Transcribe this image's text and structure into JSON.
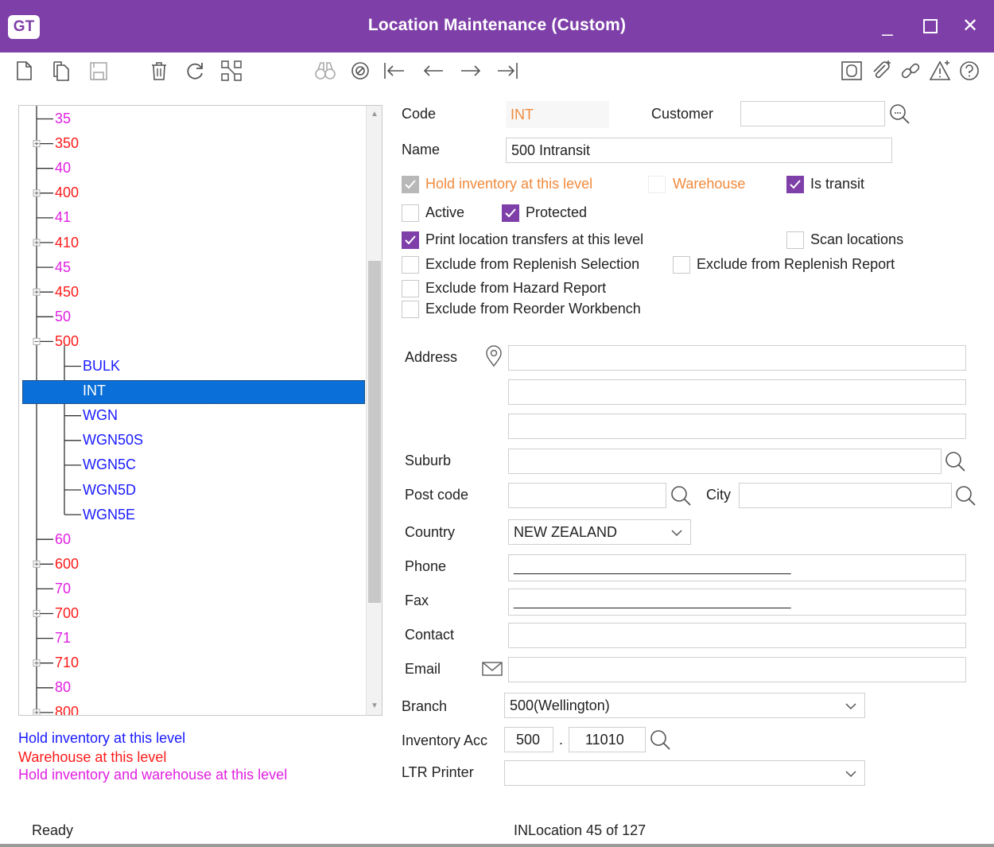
{
  "window": {
    "logo": "GT",
    "title": "Location Maintenance (Custom)",
    "minimize_glyph": "_",
    "maximize_glyph": "☐",
    "close_glyph": "✕"
  },
  "toolbar": {
    "left_icons": [
      "new-document-icon",
      "copy-document-icon",
      "save-icon",
      "delete-icon",
      "refresh-icon",
      "structure-icon"
    ],
    "nav_icons": [
      "binoculars-icon",
      "target-icon",
      "first-record-icon",
      "previous-record-icon",
      "next-record-icon",
      "last-record-icon"
    ],
    "right_icons": [
      "notes-icon",
      "attachment-icon",
      "link-icon",
      "alert-icon",
      "help-icon"
    ]
  },
  "tree": {
    "nodes": [
      {
        "label": "35",
        "color": "mag"
      },
      {
        "label": "350",
        "color": "red"
      },
      {
        "label": "40",
        "color": "mag"
      },
      {
        "label": "400",
        "color": "red"
      },
      {
        "label": "41",
        "color": "mag"
      },
      {
        "label": "410",
        "color": "red"
      },
      {
        "label": "45",
        "color": "mag"
      },
      {
        "label": "450",
        "color": "red"
      },
      {
        "label": "50",
        "color": "mag"
      },
      {
        "label": "500",
        "color": "red"
      },
      {
        "label": "BULK",
        "color": "blue"
      },
      {
        "label": "INT",
        "color": "sel"
      },
      {
        "label": "WGN",
        "color": "blue"
      },
      {
        "label": "WGN50S",
        "color": "blue"
      },
      {
        "label": "WGN5C",
        "color": "blue"
      },
      {
        "label": "WGN5D",
        "color": "blue"
      },
      {
        "label": "WGN5E",
        "color": "blue"
      },
      {
        "label": "60",
        "color": "mag"
      },
      {
        "label": "600",
        "color": "red"
      },
      {
        "label": "70",
        "color": "mag"
      },
      {
        "label": "700",
        "color": "red"
      },
      {
        "label": "71",
        "color": "mag"
      },
      {
        "label": "710",
        "color": "red"
      },
      {
        "label": "80",
        "color": "mag"
      },
      {
        "label": "800",
        "color": "red"
      }
    ]
  },
  "legend": {
    "hold": "Hold inventory at this level",
    "warehouse": "Warehouse at this level",
    "both": "Hold inventory and warehouse at this level",
    "colors": {
      "hold": "#1a1aff",
      "warehouse": "#ff1a1a",
      "both": "#e01fe0"
    }
  },
  "form": {
    "code_label": "Code",
    "code_value": "INT",
    "customer_label": "Customer",
    "customer_value": "",
    "name_label": "Name",
    "name_value": "500 Intransit",
    "checkboxes": {
      "hold_inventory": {
        "label": "Hold inventory at this level",
        "checked": true
      },
      "warehouse": {
        "label": "Warehouse",
        "checked": false
      },
      "is_transit": {
        "label": "Is transit",
        "checked": true
      },
      "active": {
        "label": "Active",
        "checked": false
      },
      "protected": {
        "label": "Protected",
        "checked": true
      },
      "print_transfers": {
        "label": "Print location transfers at this level",
        "checked": true
      },
      "scan_locations": {
        "label": "Scan locations",
        "checked": false
      },
      "excl_replenish_sel": {
        "label": "Exclude from Replenish Selection",
        "checked": false
      },
      "excl_replenish_rep": {
        "label": "Exclude from Replenish Report",
        "checked": false
      },
      "excl_hazard": {
        "label": "Exclude from Hazard Report",
        "checked": false
      },
      "excl_reorder": {
        "label": "Exclude from Reorder Workbench",
        "checked": false
      }
    },
    "address_label": "Address",
    "address_line1": "",
    "address_line2": "",
    "address_line3": "",
    "suburb_label": "Suburb",
    "suburb_value": "",
    "postcode_label": "Post code",
    "postcode_value": "",
    "city_label": "City",
    "city_value": "",
    "country_label": "Country",
    "country_value": "NEW ZEALAND",
    "phone_label": "Phone",
    "phone_value": "____________________________________________",
    "fax_label": "Fax",
    "fax_value": "____________________________________________",
    "contact_label": "Contact",
    "contact_value": "",
    "email_label": "Email",
    "email_value": "",
    "branch_label": "Branch",
    "branch_value": "500(Wellington)",
    "inventory_acc_label": "Inventory Acc",
    "inventory_acc_part1": "500",
    "inventory_acc_sep": ".",
    "inventory_acc_part2": "11010",
    "ltr_printer_label": "LTR Printer",
    "ltr_printer_value": ""
  },
  "status": {
    "left": "Ready",
    "center": "INLocation 45 of 127"
  },
  "colors": {
    "accent": "#7e3fa8",
    "selection": "#0a6fd8",
    "code_text": "#f08a3c"
  }
}
